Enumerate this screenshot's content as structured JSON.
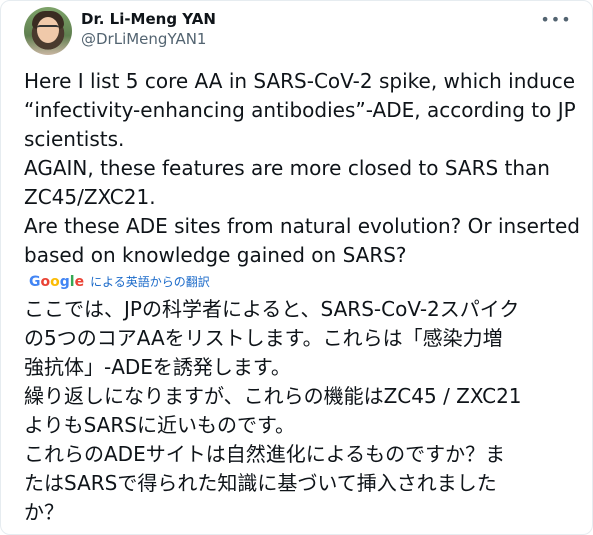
{
  "author": {
    "display_name": "Dr. Li-Meng YAN",
    "handle": "@DrLiMengYAN1"
  },
  "icons": {
    "avatar": "profile-photo",
    "more": "more-options-icon",
    "google": "google-logo"
  },
  "tweet": {
    "text": "Here I list 5 core AA in SARS-CoV-2 spike, which induce\n“infectivity-enhancing antibodies”-ADE,  according to JP\nscientists.\nAGAIN, these features are more closed to SARS than\nZC45/ZXC21.\nAre these ADE sites from natural evolution? Or inserted\nbased on knowledge gained on SARS?"
  },
  "translation": {
    "provider": "Google",
    "label": "による英語からの翻訳",
    "text": "ここでは、JPの科学者によると、SARS-CoV-2スパイク\nの5つのコアAAをリストします。これらは「感染力増\n強抗体」-ADEを誘発します。\n繰り返しになりますが、これらの機能はZC45 / ZXC21\nよりもSARSに近いものです。\nこれらのADEサイトは自然進化によるものですか？ま\nたはSARSで得られた知識に基づいて挿入されました\nか？"
  },
  "colors": {
    "text": "#0f1419",
    "secondary": "#536471",
    "link": "#1b6ac9",
    "border": "#e6ecf0"
  }
}
